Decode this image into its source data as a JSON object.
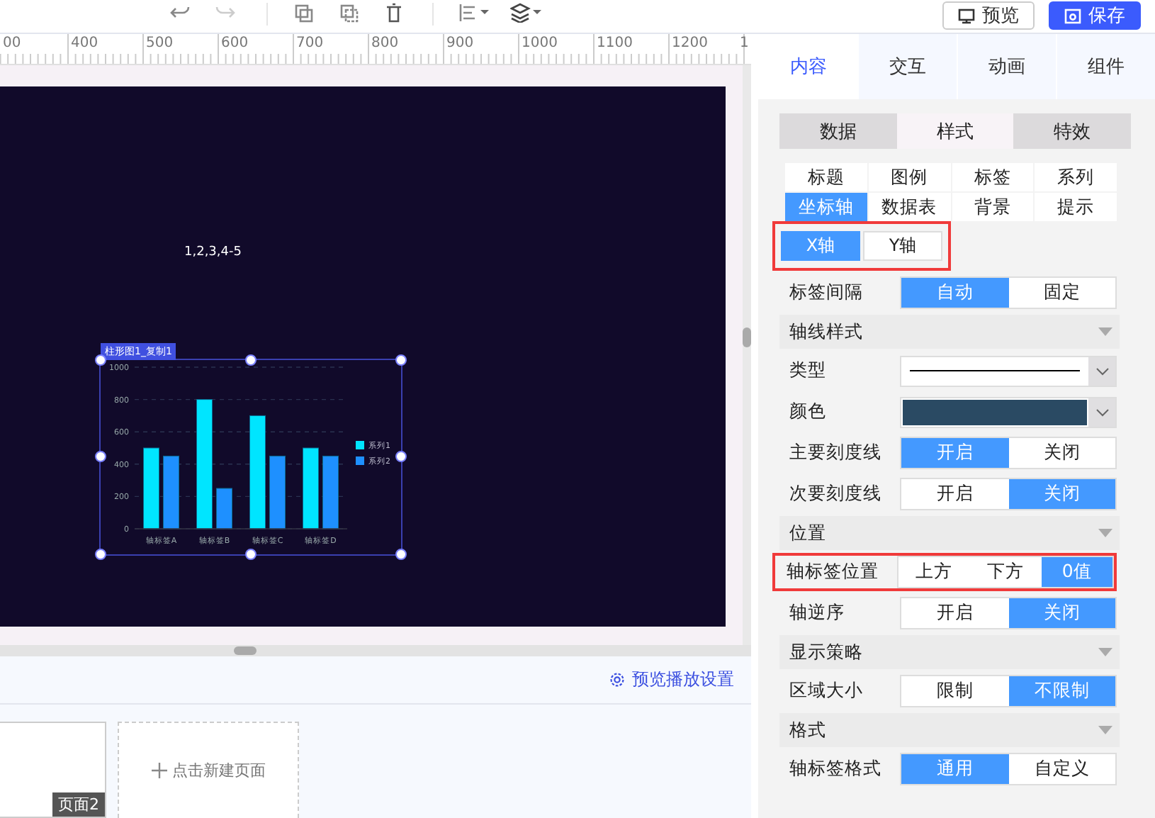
{
  "toolbar": {
    "buttons": [
      {
        "label": "预览",
        "kind": "outline"
      },
      {
        "label": "保存",
        "kind": "primary"
      }
    ]
  },
  "ruler": {
    "labels": [
      "00",
      "400",
      "500",
      "600",
      "700",
      "800",
      "900",
      "1000",
      "1100",
      "1200",
      "1"
    ]
  },
  "canvas": {
    "text": "1,2,3,4-5",
    "chart": {
      "tag": "柱形图1_复制1",
      "selected": true,
      "chart_data": {
        "type": "bar",
        "grid": true,
        "legend": true,
        "categories": [
          "轴标签A",
          "轴标签B",
          "轴标签C",
          "轴标签D"
        ],
        "ylim": [
          0,
          1000
        ],
        "yticks": [
          {
            "value": 0,
            "label": "0"
          },
          {
            "value": 200,
            "label": "200"
          },
          {
            "value": 400,
            "label": "400"
          },
          {
            "value": 600,
            "label": "600"
          },
          {
            "value": 800,
            "label": "800"
          },
          {
            "value": 1000,
            "label": "1000"
          }
        ],
        "series": [
          {
            "name": "系列1",
            "color": "#00e5ff",
            "values": [
              500,
              800,
              700,
              500
            ]
          },
          {
            "name": "系列2",
            "color": "#1e90ff",
            "values": [
              450,
              250,
              450,
              450
            ]
          }
        ]
      }
    }
  },
  "pages": {
    "settings_link": "预览播放设置",
    "page_badge": "页面2",
    "new_page": "点击新建页面"
  },
  "right_panel": {
    "tabs": [
      {
        "label": "内容",
        "selected": true
      },
      {
        "label": "交互",
        "selected": false
      },
      {
        "label": "动画",
        "selected": false
      },
      {
        "label": "组件",
        "selected": false
      }
    ],
    "style_tabs": [
      {
        "label": "数据",
        "selected": false
      },
      {
        "label": "样式",
        "selected": true
      },
      {
        "label": "特效",
        "selected": false
      }
    ],
    "sub_tabs": [
      {
        "label": "标题",
        "selected": false
      },
      {
        "label": "图例",
        "selected": false
      },
      {
        "label": "标签",
        "selected": false
      },
      {
        "label": "系列",
        "selected": false
      },
      {
        "label": "坐标轴",
        "selected": true
      },
      {
        "label": "数据表",
        "selected": false
      },
      {
        "label": "背景",
        "selected": false
      },
      {
        "label": "提示",
        "selected": false
      }
    ],
    "axis_tabs": {
      "highlighted": true,
      "items": [
        {
          "label": "X轴",
          "selected": true
        },
        {
          "label": "Y轴",
          "selected": false
        }
      ]
    },
    "settings": [
      {
        "kind": "toggle",
        "label": "标签间隔",
        "options": [
          {
            "label": "自动",
            "selected": true
          },
          {
            "label": "固定",
            "selected": false
          }
        ]
      },
      {
        "kind": "section",
        "label": "轴线样式"
      },
      {
        "kind": "line",
        "label": "类型"
      },
      {
        "kind": "color",
        "label": "颜色",
        "color": "#2a4a63"
      },
      {
        "kind": "toggle",
        "label": "主要刻度线",
        "options": [
          {
            "label": "开启",
            "selected": true
          },
          {
            "label": "关闭",
            "selected": false
          }
        ]
      },
      {
        "kind": "toggle",
        "label": "次要刻度线",
        "options": [
          {
            "label": "开启",
            "selected": false
          },
          {
            "label": "关闭",
            "selected": true
          }
        ]
      },
      {
        "kind": "section",
        "label": "位置"
      },
      {
        "kind": "toggle",
        "label": "轴标签位置",
        "highlighted": true,
        "options": [
          {
            "label": "上方",
            "selected": false
          },
          {
            "label": "下方",
            "selected": false
          },
          {
            "label": "0值",
            "selected": true
          }
        ]
      },
      {
        "kind": "toggle",
        "label": "轴逆序",
        "options": [
          {
            "label": "开启",
            "selected": false
          },
          {
            "label": "关闭",
            "selected": true
          }
        ]
      },
      {
        "kind": "section",
        "label": "显示策略"
      },
      {
        "kind": "toggle",
        "label": "区域大小",
        "options": [
          {
            "label": "限制",
            "selected": false
          },
          {
            "label": "不限制",
            "selected": true
          }
        ]
      },
      {
        "kind": "section",
        "label": "格式"
      },
      {
        "kind": "toggle",
        "label": "轴标签格式",
        "options": [
          {
            "label": "通用",
            "selected": true
          },
          {
            "label": "自定义",
            "selected": false
          }
        ]
      }
    ]
  }
}
